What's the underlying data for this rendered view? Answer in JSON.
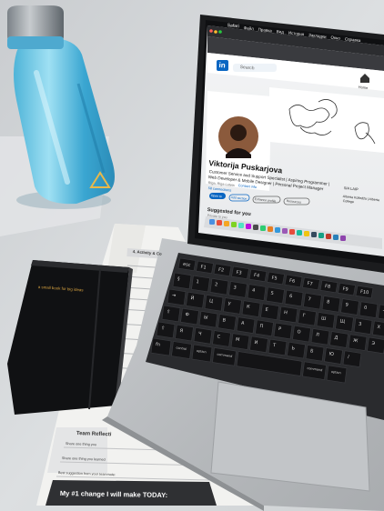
{
  "laptop": {
    "menubar": {
      "app_name": "Safari",
      "items": [
        "Файл",
        "Правка",
        "Вид",
        "История",
        "Закладки",
        "Окно",
        "Справка"
      ]
    },
    "linkedin": {
      "logo_text": "in",
      "search_placeholder": "Search",
      "home_label": "Home",
      "profile_name": "Viktorija Puskarjova",
      "headline_lines": [
        "Customer Service and Support Specialist | Aspiring Programmer |",
        "Web Developer & Mobile Designer | Personal Project Manager"
      ],
      "location": "Riga, Riga Latvia",
      "contact_info": "Contact info",
      "connections": "58 connections",
      "buttons": [
        "Open to",
        "Add section",
        "Enhance profile",
        "Resources"
      ],
      "suggested_title": "Suggested for you",
      "suggested_sub": "Private to you",
      "company": "SIA LAIP",
      "education_lines": [
        "Alberta Kolledža | Alberta",
        "College"
      ]
    }
  },
  "notebook": {
    "cover_text": "a small book for big ideas"
  },
  "worksheet": {
    "section_title": "4. Activity & Co",
    "team_heading": "Team Reflecti",
    "lines": [
      "Share one thing you",
      "Share one thing you learned",
      "Best suggestion from your teammate:"
    ],
    "banner_text": "My #1 change I will make TODAY:"
  },
  "keyboard": {
    "row1": [
      "esc",
      "F1",
      "F2",
      "F3",
      "F4",
      "F5",
      "F6",
      "F7",
      "F8",
      "F9",
      "F10"
    ],
    "row2": [
      "§",
      "1",
      "2",
      "3",
      "4",
      "5",
      "6",
      "7",
      "8",
      "9",
      "0",
      "-"
    ],
    "row3": [
      "⇥",
      "Й",
      "Ц",
      "У",
      "К",
      "Е",
      "Н",
      "Г",
      "Ш",
      "Щ",
      "З",
      "Х"
    ],
    "row4": [
      "⇪",
      "Ф",
      "Ы",
      "В",
      "А",
      "П",
      "Р",
      "О",
      "Л",
      "Д",
      "Ж",
      "Э"
    ],
    "row5": [
      "⇧",
      "Я",
      "Ч",
      "С",
      "М",
      "И",
      "Т",
      "Ь",
      "Б",
      "Ю",
      "/"
    ],
    "row6": [
      "fn",
      "control",
      "option",
      "command",
      "",
      "command",
      "option"
    ]
  }
}
